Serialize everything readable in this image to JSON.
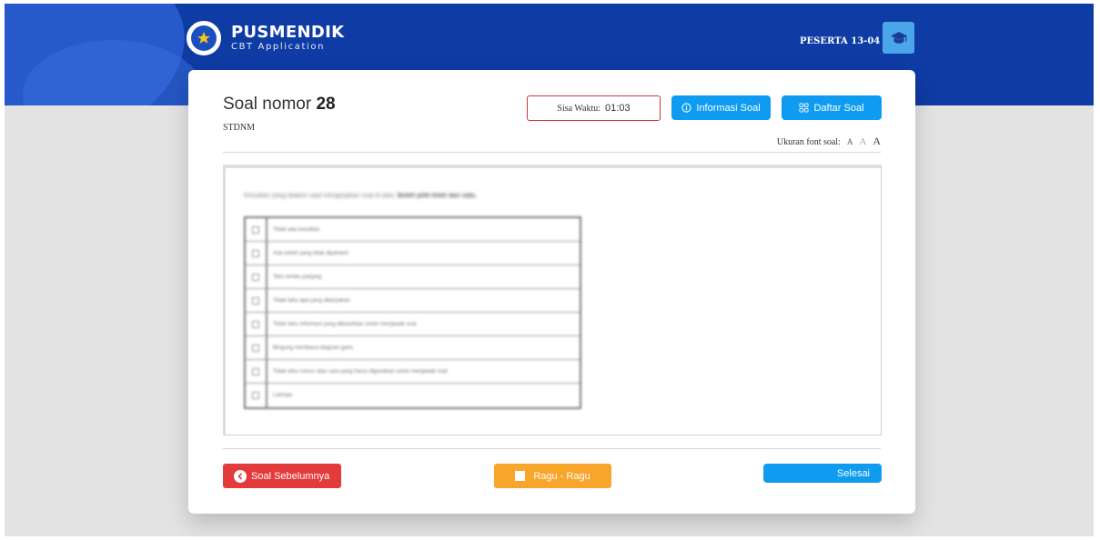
{
  "header": {
    "app_title": "PUSMENDIK",
    "app_subtitle": "CBT Application",
    "user_label": "PESERTA 13-04",
    "icons": {
      "logo": "tut-wuri-handayani-logo",
      "user": "graduation-cap-icon"
    },
    "color": "#0f3ba5"
  },
  "question": {
    "title_prefix": "Soal nomor",
    "number": "28",
    "code": "STDNM",
    "timer_label": "Sisa Waktu:",
    "timer_value": "01:03",
    "info_button": "Informasi Soal",
    "list_button": "Daftar Soal",
    "font_size_label": "Ukuran font soal:",
    "font_size_options": [
      "A",
      "A",
      "A"
    ],
    "prompt_text": "Kesulitan yang dialami saat mengerjakan soal di atas.",
    "prompt_emphasis": "Boleh pilih lebih dari satu.",
    "options": [
      "Tidak ada kesulitan",
      "Ada istilah yang tidak dipahami",
      "Teks terlalu panjang",
      "Tidak tahu apa yang ditanyakan",
      "Tidak tahu informasi yang dibutuhkan untuk menjawab soal",
      "Bingung membaca diagram garis",
      "Tidak tahu rumus atau cara yang harus digunakan untuk menjawab soal",
      "Lainnya"
    ]
  },
  "footer": {
    "prev_button": "Soal Sebelumnya",
    "doubt_button": "Ragu - Ragu",
    "finish_button": "Selesai"
  },
  "colors": {
    "primary_blue": "#0f9cf0",
    "danger_red": "#e33b3b",
    "warning_orange": "#f8a52c"
  }
}
